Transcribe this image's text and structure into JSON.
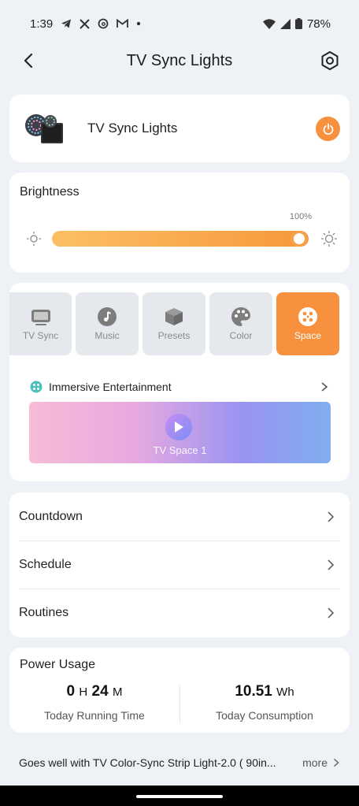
{
  "status_bar": {
    "time": "1:39",
    "battery": "78%",
    "icons": [
      "telegram-icon",
      "x-icon",
      "threads-icon",
      "gmail-icon",
      "dot-icon",
      "wifi-icon",
      "signal-icon",
      "battery-icon"
    ]
  },
  "header": {
    "title": "TV Sync Lights"
  },
  "device": {
    "name": "TV Sync Lights",
    "power_on": true
  },
  "brightness": {
    "title": "Brightness",
    "value_label": "100%",
    "level": 1.0
  },
  "modes": {
    "tabs": [
      {
        "label": "TV Sync",
        "icon": "tv-icon"
      },
      {
        "label": "Music",
        "icon": "music-note-icon"
      },
      {
        "label": "Presets",
        "icon": "cube-icon"
      },
      {
        "label": "Color",
        "icon": "palette-icon"
      },
      {
        "label": "Space",
        "icon": "space-icon"
      }
    ],
    "active": "Space",
    "immersive_label": "Immersive Entertainment",
    "banner_label": "TV Space 1"
  },
  "menu": {
    "items": [
      "Countdown",
      "Schedule",
      "Routines"
    ]
  },
  "power_usage": {
    "title": "Power Usage",
    "hours": "0",
    "hours_unit": "H",
    "minutes": "24",
    "minutes_unit": "M",
    "running_label": "Today Running Time",
    "consumption": "10.51",
    "consumption_unit": "Wh",
    "consumption_label": "Today Consumption"
  },
  "suggestion": {
    "text": "Goes well with TV Color-Sync Strip Light-2.0 ( 90in...",
    "more": "more"
  },
  "colors": {
    "accent": "#f7913d",
    "background": "#eef2f6"
  }
}
